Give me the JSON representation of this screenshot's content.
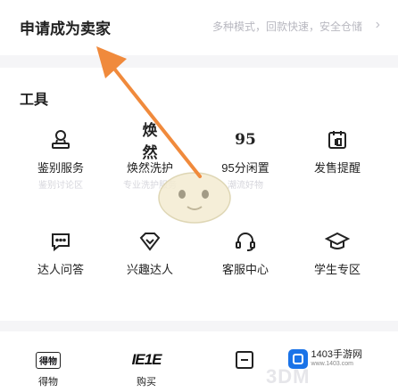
{
  "seller": {
    "title": "申请成为卖家",
    "subtitle": "多种模式，回款快速，安全仓储"
  },
  "tools": {
    "title": "工具",
    "items": [
      {
        "icon": "stamp-icon",
        "label": "鉴别服务",
        "sub": "鉴别讨论区"
      },
      {
        "icon": "huanran-logo-icon",
        "icon_text": "焕然",
        "label": "焕然洗护",
        "sub": "专业洗护服务"
      },
      {
        "icon": "95-logo-icon",
        "icon_text": "95",
        "label": "95分闲置",
        "sub": "潮流好物"
      },
      {
        "icon": "calendar-icon",
        "label": "发售提醒",
        "sub": ""
      },
      {
        "icon": "chat-bubble-icon",
        "label": "达人问答",
        "sub": ""
      },
      {
        "icon": "diamond-icon",
        "label": "兴趣达人",
        "sub": ""
      },
      {
        "icon": "headset-icon",
        "label": "客服中心",
        "sub": ""
      },
      {
        "icon": "graduation-cap-icon",
        "label": "学生专区",
        "sub": ""
      }
    ]
  },
  "bottom": {
    "items": [
      {
        "icon": "dewu-logo-icon",
        "icon_text": "得物",
        "label": "得物"
      },
      {
        "icon": "goumai-logo-icon",
        "icon_text": "IE1E",
        "label": "购买"
      },
      {
        "icon": "app-logo-icon",
        "label": ""
      }
    ],
    "brand": {
      "name": "1403手游网",
      "url": "www.1403.com"
    },
    "watermark": "3DM"
  },
  "colors": {
    "arrow": "#f08a3c",
    "brand_blue": "#1a73e8"
  }
}
